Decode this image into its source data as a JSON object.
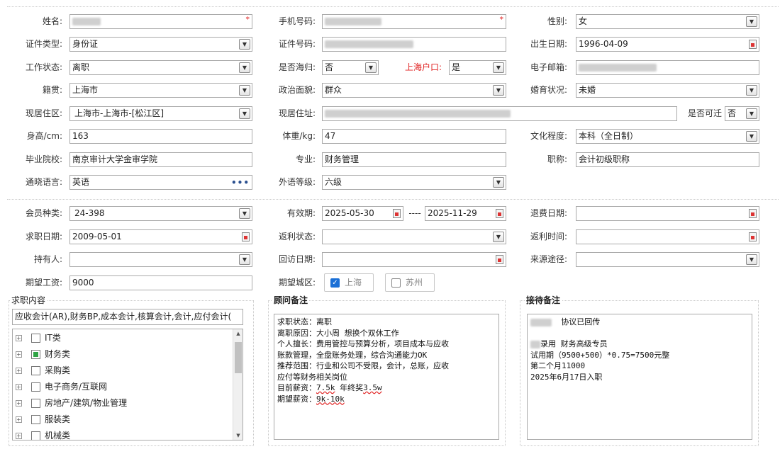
{
  "personal": {
    "name_label": "姓名:",
    "name_req": "*",
    "phone_label": "手机号码:",
    "phone_req": "*",
    "gender_label": "性别:",
    "gender_value": "女",
    "id_type_label": "证件类型:",
    "id_type_value": "身份证",
    "id_no_label": "证件号码:",
    "birth_label": "出生日期:",
    "birth_value": "1996-04-09",
    "work_status_label": "工作状态:",
    "work_status_value": "离职",
    "returnee_label": "是否海归:",
    "returnee_value": "否",
    "sh_hukou_label": "上海户口:",
    "sh_hukou_value": "是",
    "email_label": "电子邮箱:",
    "native_label": "籍贯:",
    "native_value": "上海市",
    "political_label": "政治面貌:",
    "political_value": "群众",
    "marital_label": "婚育状况:",
    "marital_value": "未婚",
    "residence_label": "现居住区:",
    "residence_value": "上海市-上海市-[松江区]",
    "address_label": "现居住址:",
    "relocate_label": "是否可迁",
    "relocate_value": "否",
    "height_label": "身高/cm:",
    "height_value": "163",
    "weight_label": "体重/kg:",
    "weight_value": "47",
    "education_label": "文化程度:",
    "education_value": "本科（全日制）",
    "school_label": "毕业院校:",
    "school_value": "南京审计大学金审学院",
    "major_label": "专业:",
    "major_value": "财务管理",
    "title_label": "职称:",
    "title_value": "会计初级职称",
    "language_label": "通晓语言:",
    "language_value": "英语",
    "lang_level_label": "外语等级:",
    "lang_level_value": "六级"
  },
  "membership": {
    "member_type_label": "会员种类:",
    "member_type_value": "24-398",
    "validity_label": "有效期:",
    "validity_start": "2025-05-30",
    "validity_sep": "----",
    "validity_end": "2025-11-29",
    "refund_date_label": "退费日期:",
    "job_date_label": "求职日期:",
    "job_date_value": "2009-05-01",
    "rebate_status_label": "返利状态:",
    "rebate_time_label": "返利时间:",
    "holder_label": "持有人:",
    "visit_date_label": "回访日期:",
    "source_label": "来源途径:",
    "salary_label": "期望工资:",
    "salary_value": "9000",
    "city_label": "期望城区:",
    "cities": [
      {
        "label": "上海",
        "checked": true
      },
      {
        "label": "苏州",
        "checked": false
      }
    ]
  },
  "job_content": {
    "title": "求职内容",
    "summary": "应收会计(AR),财务BP,成本会计,核算会计,会计,应付会计(",
    "tree": [
      {
        "label": "IT类",
        "state": "none"
      },
      {
        "label": "财务类",
        "state": "partial"
      },
      {
        "label": "采购类",
        "state": "none"
      },
      {
        "label": "电子商务/互联网",
        "state": "none"
      },
      {
        "label": "房地产/建筑/物业管理",
        "state": "none"
      },
      {
        "label": "服装类",
        "state": "none"
      },
      {
        "label": "机械类",
        "state": "none"
      }
    ]
  },
  "advisor_notes": {
    "title": "顾问备注",
    "line1": "求职状态：离职",
    "line2": "离职原因：大小周 想换个双休工作",
    "line3": "个人擅长：费用管控与预算分析，项目成本与应收",
    "line4": "账款管理，全盘账务处理，综合沟通能力OK",
    "line5": "推荐范围：行业和公司不受限，会计，总账，应收",
    "line6": "应付等财务相关岗位",
    "line7a": "目前薪资：",
    "line7b": "7.5k",
    "line7c": " 年终奖",
    "line7d": "3.5w",
    "line8a": "期望薪资：",
    "line8b": "9k-10k"
  },
  "reception_notes": {
    "title": "接待备注",
    "line1": "协议已回传",
    "line2": "录用 财务高级专员",
    "line3": "试用期（9500+500）*0.75=7500元整",
    "line4": "第二个月11000",
    "line5": "2025年6月17日入职"
  },
  "icons": {
    "dropdown": "▼",
    "more": "•••",
    "expand": "+",
    "scroll_up": "▲",
    "scroll_down": "▼",
    "check": "✓"
  }
}
